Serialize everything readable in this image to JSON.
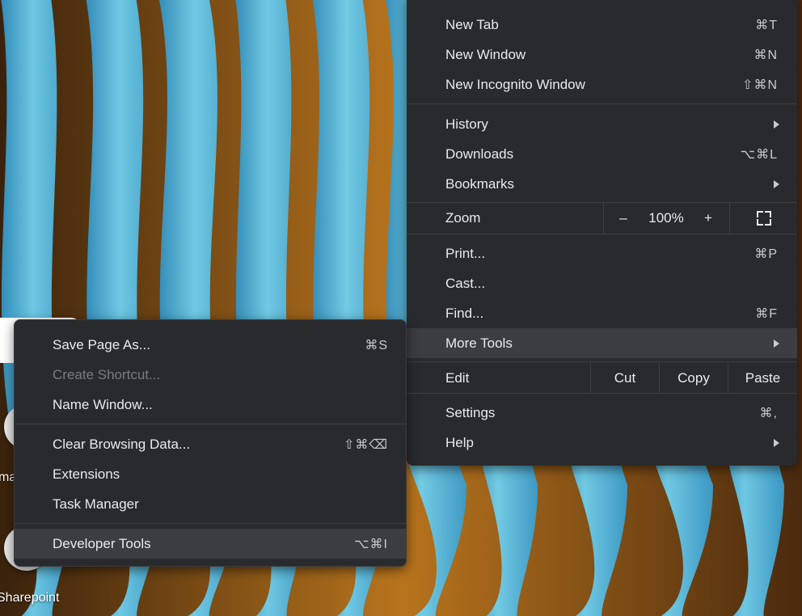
{
  "main_menu": {
    "items_top": [
      {
        "label": "New Tab",
        "shortcut": "⌘T"
      },
      {
        "label": "New Window",
        "shortcut": "⌘N"
      },
      {
        "label": "New Incognito Window",
        "shortcut": "⇧⌘N"
      }
    ],
    "items_nav": [
      {
        "label": "History",
        "shortcut": "",
        "submenu": true
      },
      {
        "label": "Downloads",
        "shortcut": "⌥⌘L"
      },
      {
        "label": "Bookmarks",
        "shortcut": "",
        "submenu": true
      }
    ],
    "zoom": {
      "label": "Zoom",
      "minus": "–",
      "value": "100%",
      "plus": "+",
      "fullscreen_icon": "fullscreen-icon"
    },
    "items_mid": [
      {
        "label": "Print...",
        "shortcut": "⌘P"
      },
      {
        "label": "Cast...",
        "shortcut": ""
      },
      {
        "label": "Find...",
        "shortcut": "⌘F"
      },
      {
        "label": "More Tools",
        "shortcut": "",
        "submenu": true,
        "highlighted": true
      }
    ],
    "edit": {
      "label": "Edit",
      "cut": "Cut",
      "copy": "Copy",
      "paste": "Paste"
    },
    "items_bottom": [
      {
        "label": "Settings",
        "shortcut": "⌘,"
      },
      {
        "label": "Help",
        "shortcut": "",
        "submenu": true
      }
    ]
  },
  "more_tools_menu": {
    "group1": [
      {
        "label": "Save Page As...",
        "shortcut": "⌘S"
      },
      {
        "label": "Create Shortcut...",
        "shortcut": "",
        "disabled": true
      },
      {
        "label": "Name Window...",
        "shortcut": ""
      }
    ],
    "group2": [
      {
        "label": "Clear Browsing Data...",
        "shortcut": "⇧⌘⌫"
      },
      {
        "label": "Extensions",
        "shortcut": ""
      },
      {
        "label": "Task Manager",
        "shortcut": ""
      }
    ],
    "group3": [
      {
        "label": "Developer Tools",
        "shortcut": "⌥⌘I",
        "highlighted": true
      }
    ]
  },
  "background": {
    "shortcut_labels": [
      "ma",
      "Sharepoint"
    ],
    "colors": {
      "teal": "#4fb3d9",
      "amber": "#b06a14",
      "dark": "#2b1a0c",
      "menu_bg": "#292a2d",
      "menu_text": "#e8eaed"
    }
  }
}
